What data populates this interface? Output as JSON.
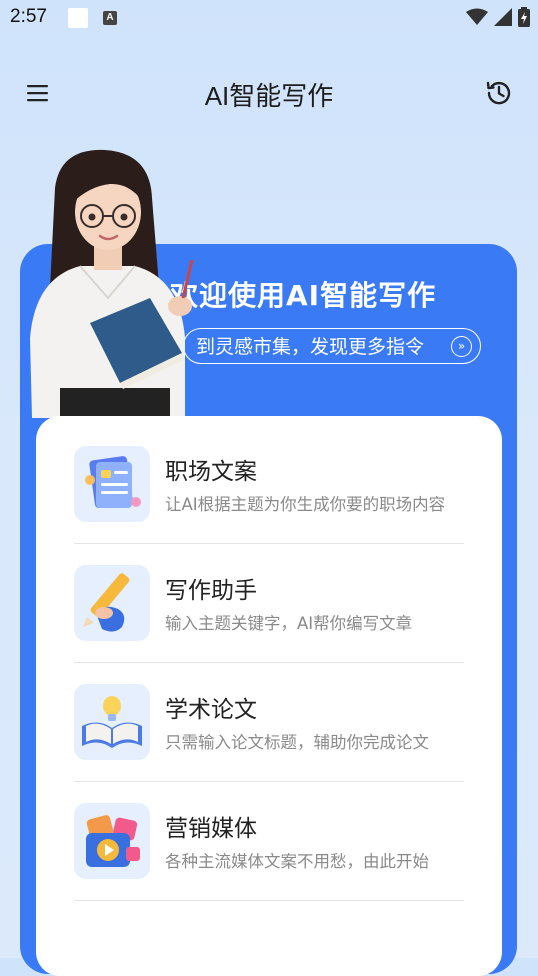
{
  "status_bar": {
    "time": "2:57",
    "a_badge": "A"
  },
  "header": {
    "title": "AI智能写作"
  },
  "banner": {
    "headline": "欢迎使用AI智能写作",
    "link_label": "到灵感市集，发现更多指令",
    "link_arrow": "»"
  },
  "features": [
    {
      "name": "职场文案",
      "description": "让AI根据主题为你生成你要的职场内容",
      "icon": "document-icon"
    },
    {
      "name": "写作助手",
      "description": "输入主题关键字，AI帮你编写文章",
      "icon": "pencil-icon"
    },
    {
      "name": "学术论文",
      "description": "只需输入论文标题，辅助你完成论文",
      "icon": "book-bulb-icon"
    },
    {
      "name": "营销媒体",
      "description": "各种主流媒体文案不用愁，由此开始",
      "icon": "media-play-icon"
    }
  ],
  "colors": {
    "banner": "#3b7af5",
    "background": "#d7e7fb",
    "card": "#ffffff"
  }
}
